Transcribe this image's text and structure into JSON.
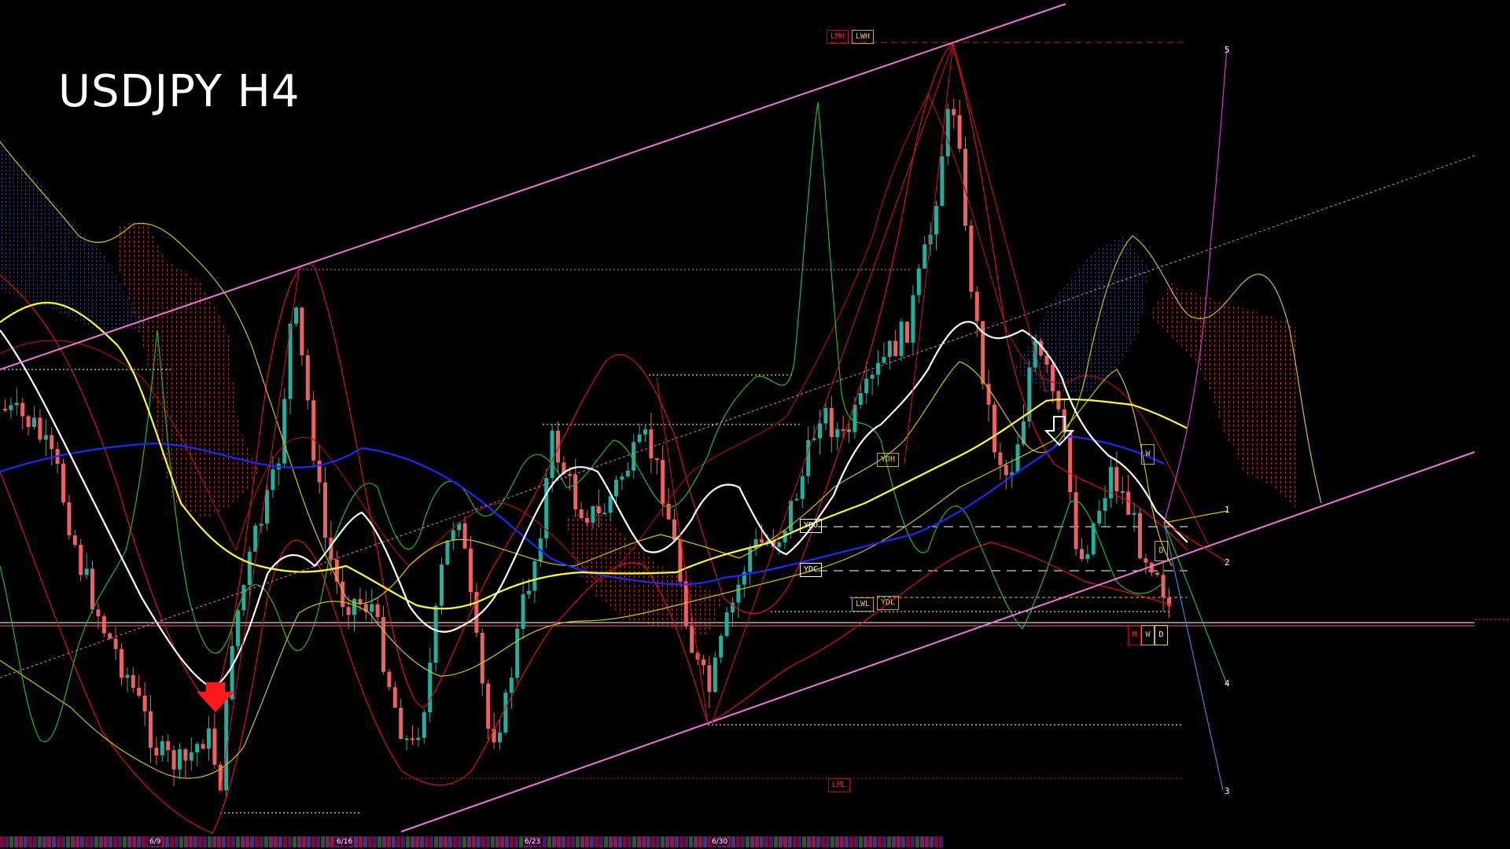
{
  "title": "USDJPY H4",
  "level_tags": {
    "lmh": "LMH",
    "lwh": "LWH",
    "lml": "LML",
    "ydo": "YDO",
    "ydc": "YDC",
    "ydh": "YDH",
    "lwl": "LWL",
    "ydl": "YDL"
  },
  "timeframe_boxes": {
    "upper_w": "W",
    "upper_d": "D",
    "lower_m": "M",
    "lower_w": "W",
    "lower_d": "D"
  },
  "projection_labels": [
    "5",
    "1",
    "2",
    "4",
    "3"
  ],
  "date_labels": [
    "6/9",
    "6/16",
    "6/23",
    "6/30"
  ],
  "colors": {
    "background": "#000000",
    "bull_candle": "#20b0a0",
    "bear_candle": "#f06060",
    "channel": "#ee77dd",
    "ma_white": "#ffffff",
    "ma_yellow": "#ffff33",
    "ma_blue": "#1a2aff",
    "bollinger": "#dd1111",
    "envelope_yellow": "#d8c000",
    "green_osc": "#22bb22",
    "cloud_red": "#c03030",
    "cloud_blue": "#2a52c8"
  },
  "icons": [
    "down-arrow-red-icon",
    "down-arrow-white-icon"
  ]
}
